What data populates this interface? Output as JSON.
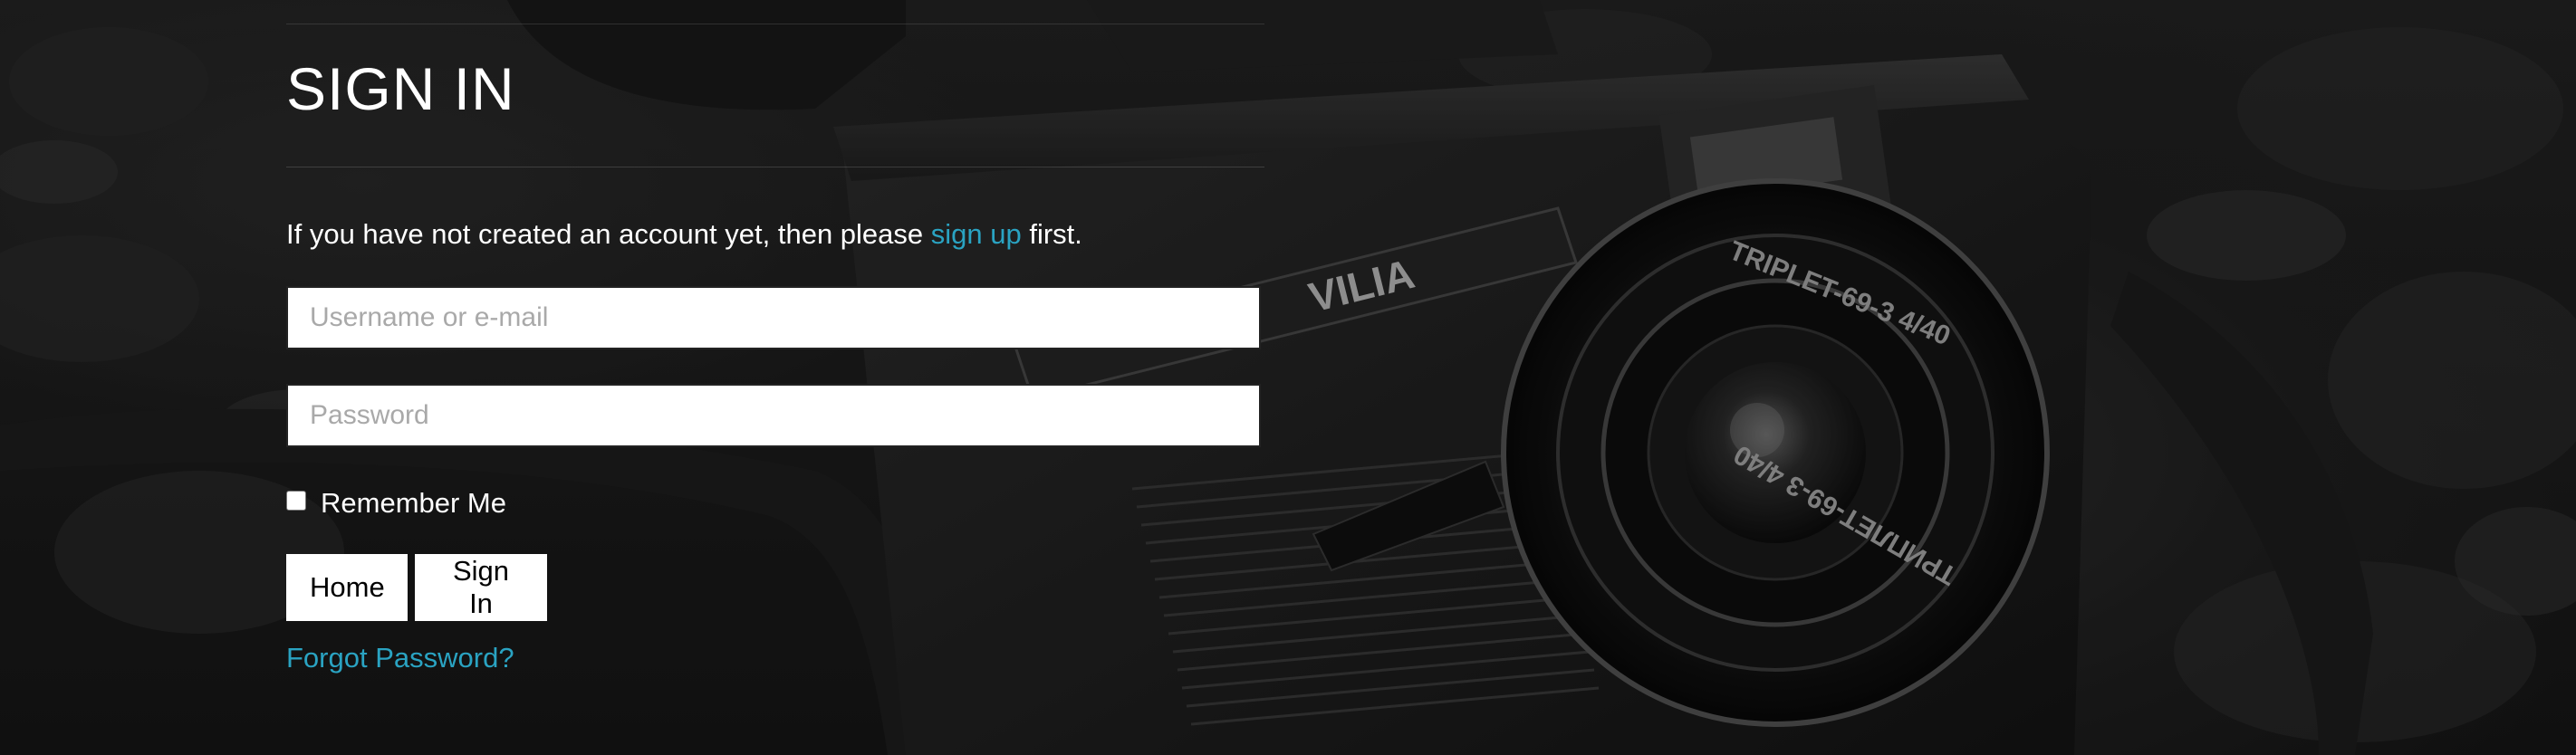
{
  "page": {
    "title": "SIGN IN",
    "intro_before": "If you have not created an account yet, then please ",
    "intro_link": "sign up",
    "intro_after": " first."
  },
  "form": {
    "username_placeholder": "Username or e-mail",
    "password_placeholder": "Password",
    "remember_label": "Remember Me",
    "remember_checked": false,
    "home_button": "Home",
    "signin_button": "Sign In",
    "forgot_link": "Forgot Password?"
  },
  "background": {
    "camera_brand_text": "VILIA",
    "lens_text_top": "TRIPLET-69-3 4/40",
    "lens_text_bottom": "ТРИПЛЕТ-69-3 4/40",
    "icon": "camera-photo-background"
  },
  "colors": {
    "link": "#2aa3c2",
    "text": "#ffffff",
    "field_bg": "#ffffff"
  }
}
